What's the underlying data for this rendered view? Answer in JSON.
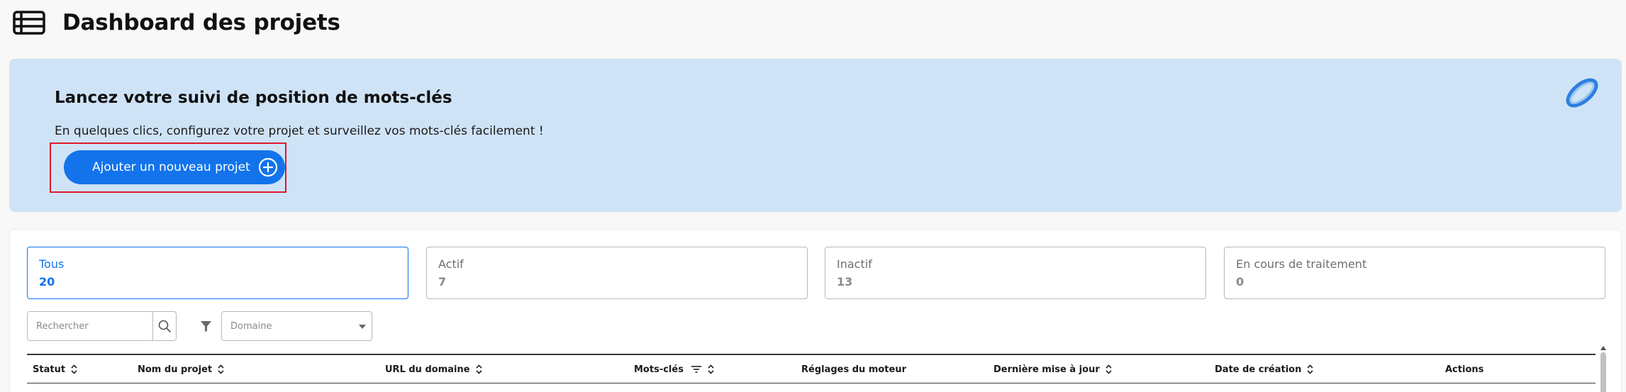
{
  "header": {
    "title": "Dashboard des projets",
    "icon": "list-menu-icon"
  },
  "banner": {
    "title": "Lancez votre suivi de position de mots-clés",
    "subtitle": "En quelques clics, configurez votre projet et surveillez vos mots-clés facilement !",
    "add_button_label": "Ajouter un nouveau projet",
    "add_button_icon": "plus-circle-icon",
    "logo": "brand-logo",
    "background_color": "#cfe3f7",
    "accent_color": "#1273eb"
  },
  "stats": [
    {
      "label": "Tous",
      "count": "20",
      "active": true
    },
    {
      "label": "Actif",
      "count": "7",
      "active": false
    },
    {
      "label": "Inactif",
      "count": "13",
      "active": false
    },
    {
      "label": "En cours de traitement",
      "count": "0",
      "active": false
    }
  ],
  "filters": {
    "search_placeholder": "Rechercher",
    "search_value": "",
    "domain_select_value": "Domaine"
  },
  "table": {
    "columns": [
      {
        "label": "Statut",
        "sort": "sort-icon"
      },
      {
        "label": "Nom du projet",
        "sort": "sort-icon"
      },
      {
        "label": "URL du domaine",
        "sort": "sort-icon"
      },
      {
        "label": "Mots-clés",
        "sort": "sort-icon",
        "filter": "filter-lines-icon"
      },
      {
        "label": "Réglages du moteur"
      },
      {
        "label": "Dernière mise à jour",
        "sort": "sort-icon"
      },
      {
        "label": "Date de création",
        "sort": "sort-icon"
      },
      {
        "label": "Actions"
      }
    ]
  }
}
